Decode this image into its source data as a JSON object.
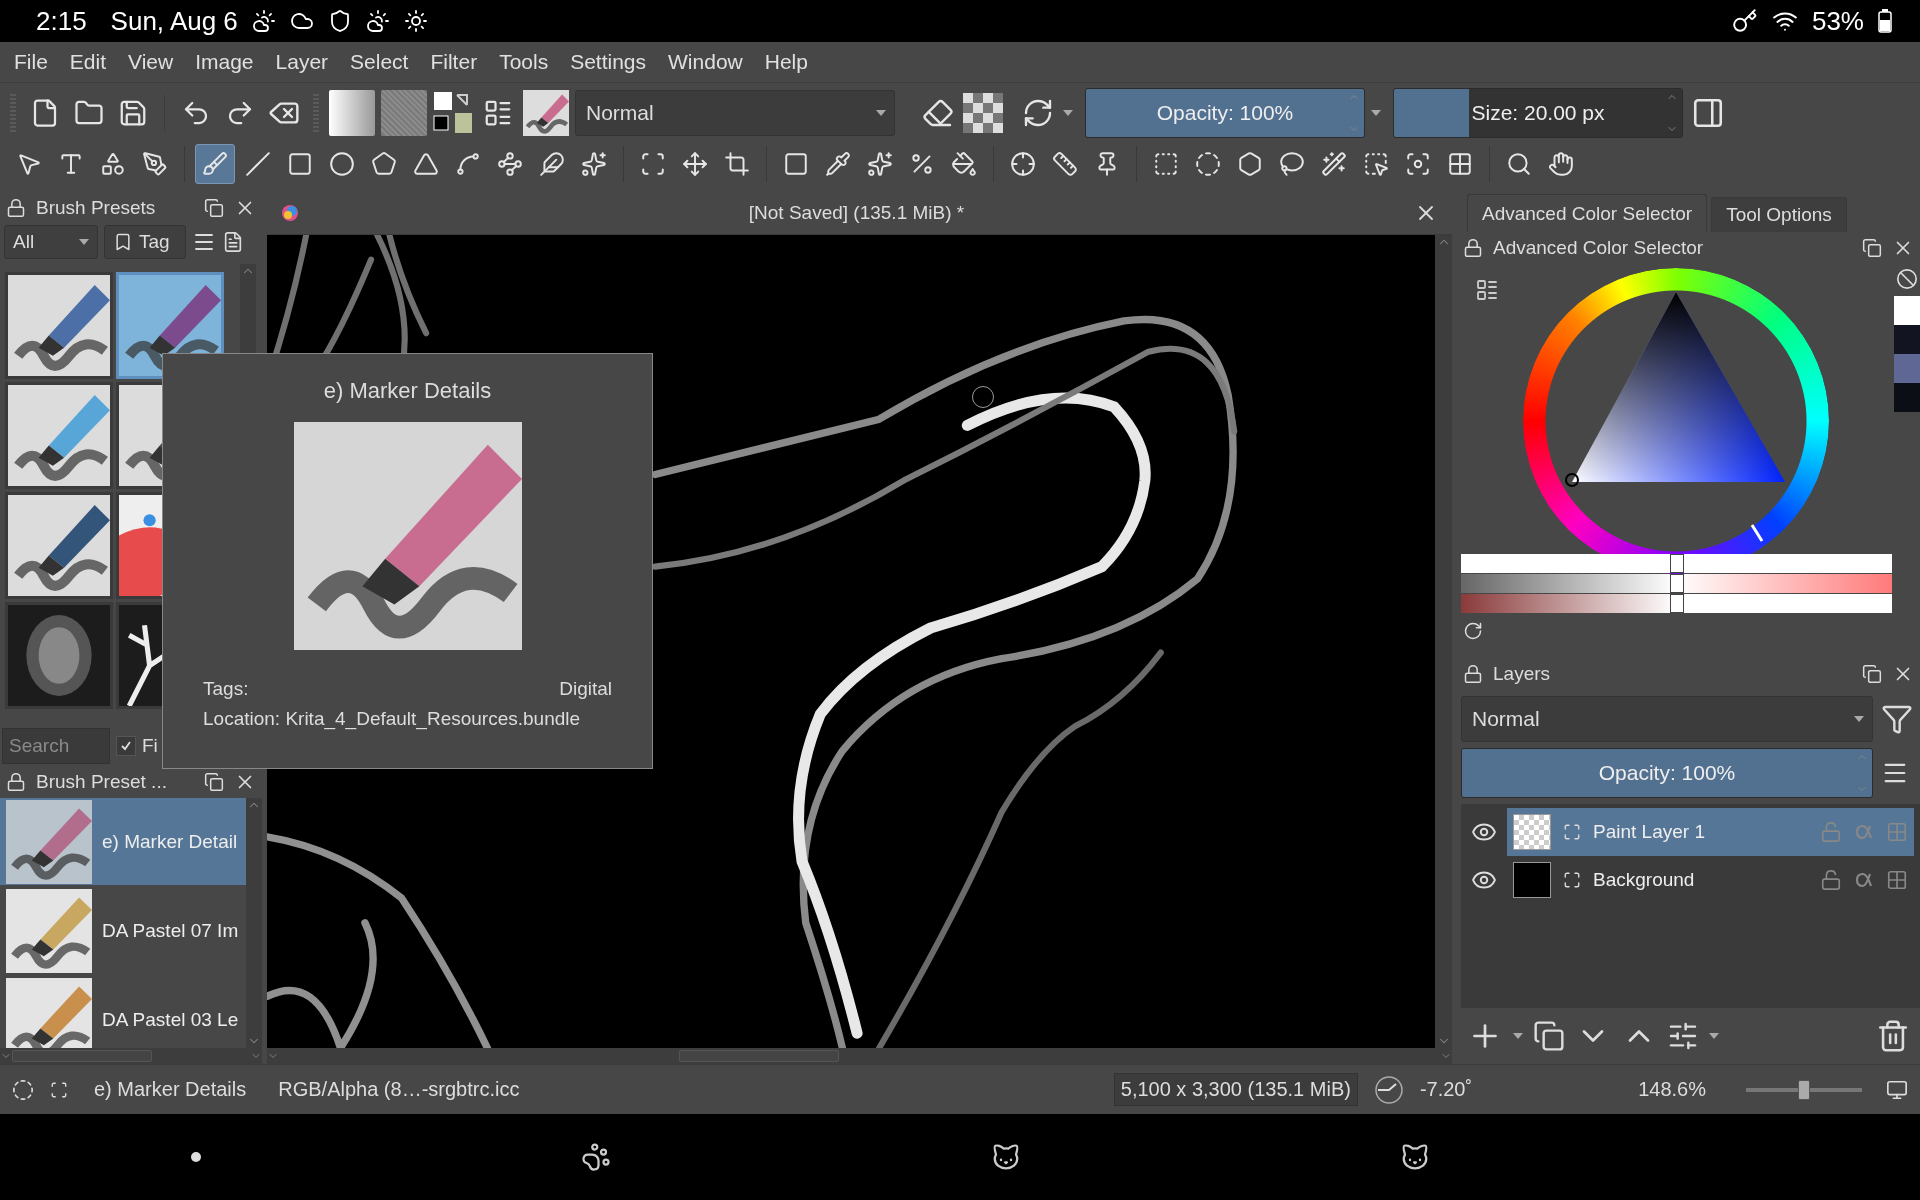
{
  "android_status": {
    "time": "2:15",
    "date": "Sun, Aug 6",
    "battery": "53%"
  },
  "menu": [
    "File",
    "Edit",
    "View",
    "Image",
    "Layer",
    "Select",
    "Filter",
    "Tools",
    "Settings",
    "Window",
    "Help"
  ],
  "toolbar": {
    "blend_mode": "Normal",
    "opacity": {
      "label": "Opacity: 100%",
      "level": 1
    },
    "size": {
      "label": "Size: 20.00 px",
      "level": 0.26
    }
  },
  "tool_groups": [
    {
      "tools": [
        {
          "selected": false
        },
        {
          "selected": false
        },
        {
          "selected": false
        },
        {
          "selected": false
        }
      ]
    },
    {
      "tools": [
        {
          "selected": true
        },
        {
          "selected": false
        },
        {
          "selected": false
        },
        {
          "selected": false
        },
        {
          "selected": false
        },
        {
          "selected": false
        },
        {
          "selected": false
        },
        {
          "selected": false
        },
        {
          "selected": false
        },
        {
          "selected": false
        }
      ]
    },
    {
      "tools": [
        {
          "selected": false
        },
        {
          "selected": false
        },
        {
          "selected": false
        }
      ]
    },
    {
      "tools": [
        {
          "selected": false
        },
        {
          "selected": false
        },
        {
          "selected": false
        },
        {
          "selected": false
        },
        {
          "selected": false
        }
      ]
    },
    {
      "tools": [
        {
          "selected": false
        },
        {
          "selected": false
        },
        {
          "selected": false
        }
      ]
    },
    {
      "tools": [
        {
          "selected": false
        },
        {
          "selected": false
        },
        {
          "selected": false
        },
        {
          "selected": false
        },
        {
          "selected": false
        },
        {
          "selected": false
        },
        {
          "selected": false
        },
        {
          "selected": false
        }
      ]
    },
    {
      "tools": [
        {
          "selected": false
        },
        {
          "selected": false
        }
      ]
    }
  ],
  "brush_presets": {
    "title": "Brush Presets",
    "filter": "All",
    "tag_button": "Tag",
    "presets": [
      {
        "selected": false
      },
      {
        "selected": true
      },
      {
        "selected": false
      },
      {
        "selected": false
      },
      {
        "selected": false
      },
      {
        "selected": false
      },
      {
        "selected": false
      },
      {
        "selected": false
      }
    ],
    "search": {
      "placeholder": "Search"
    },
    "filter_checkbox": {
      "label": "Fi",
      "checked": true
    }
  },
  "preset_list": {
    "title": "Brush Preset ...",
    "items": [
      {
        "name": "e) Marker Detail",
        "selected": true
      },
      {
        "name": "DA Pastel 07 Im",
        "selected": false
      },
      {
        "name": "DA Pastel 03 Le",
        "selected": false
      }
    ]
  },
  "document": {
    "tab_title": "[Not Saved]  (135.1 MiB) *"
  },
  "tooltip": {
    "title": "e) Marker Details",
    "tags_label": "Tags:",
    "tags_value": "Digital",
    "location": "Location: Krita_4_Default_Resources.bundle"
  },
  "right_tabs": [
    {
      "label": "Advanced Color Selector",
      "selected": true
    },
    {
      "label": "Tool Options",
      "selected": false
    }
  ],
  "color_selector": {
    "title": "Advanced Color Selector",
    "sliders": [
      {
        "level": 0.5
      },
      {
        "level": 0.5
      },
      {
        "level": 0.5
      }
    ],
    "recent_colors": [
      {
        "color": "#ffffff"
      },
      {
        "color": "#121521"
      },
      {
        "color": "#5f6795"
      },
      {
        "color": "#0c0e16"
      }
    ]
  },
  "layers": {
    "title": "Layers",
    "blend_mode": "Normal",
    "opacity": {
      "label": "Opacity:  100%",
      "level": 1
    },
    "items": [
      {
        "name": "Paint Layer 1",
        "selected": true,
        "transparent": true
      },
      {
        "name": "Background",
        "selected": false,
        "transparent": false
      }
    ]
  },
  "status_bar": {
    "preset": "e) Marker Details",
    "color_space": "RGB/Alpha (8…-srgbtrc.icc",
    "size": "5,100 x 3,300 (135.1 MiB)",
    "rotation": "-7.20˚",
    "zoom": "148.6%",
    "zoom_slider": {
      "level": 0.5
    }
  }
}
